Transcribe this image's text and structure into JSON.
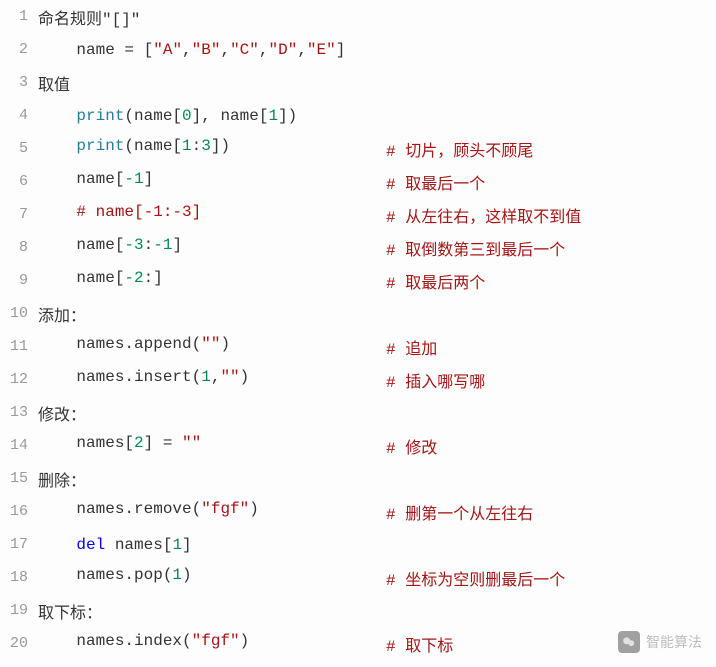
{
  "lines": [
    {
      "n": 1,
      "left": [
        {
          "t": "命名规则\"[]\"",
          "c": "tok-plain"
        }
      ],
      "right": []
    },
    {
      "n": 2,
      "left": [
        {
          "t": "    name ",
          "c": "tok-plain"
        },
        {
          "t": "=",
          "c": "tok-punct"
        },
        {
          "t": " [",
          "c": "tok-punct"
        },
        {
          "t": "\"A\"",
          "c": "tok-string"
        },
        {
          "t": ",",
          "c": "tok-punct"
        },
        {
          "t": "\"B\"",
          "c": "tok-string"
        },
        {
          "t": ",",
          "c": "tok-punct"
        },
        {
          "t": "\"C\"",
          "c": "tok-string"
        },
        {
          "t": ",",
          "c": "tok-punct"
        },
        {
          "t": "\"D\"",
          "c": "tok-string"
        },
        {
          "t": ",",
          "c": "tok-punct"
        },
        {
          "t": "\"E\"",
          "c": "tok-string"
        },
        {
          "t": "]",
          "c": "tok-punct"
        }
      ],
      "right": []
    },
    {
      "n": 3,
      "left": [
        {
          "t": "取值",
          "c": "tok-plain"
        }
      ],
      "right": []
    },
    {
      "n": 4,
      "left": [
        {
          "t": "    ",
          "c": "tok-plain"
        },
        {
          "t": "print",
          "c": "tok-builtin"
        },
        {
          "t": "(name[",
          "c": "tok-punct"
        },
        {
          "t": "0",
          "c": "tok-number"
        },
        {
          "t": "], name[",
          "c": "tok-punct"
        },
        {
          "t": "1",
          "c": "tok-number"
        },
        {
          "t": "])",
          "c": "tok-punct"
        }
      ],
      "right": []
    },
    {
      "n": 5,
      "left": [
        {
          "t": "    ",
          "c": "tok-plain"
        },
        {
          "t": "print",
          "c": "tok-builtin"
        },
        {
          "t": "(name[",
          "c": "tok-punct"
        },
        {
          "t": "1",
          "c": "tok-number"
        },
        {
          "t": ":",
          "c": "tok-punct"
        },
        {
          "t": "3",
          "c": "tok-number"
        },
        {
          "t": "])",
          "c": "tok-punct"
        }
      ],
      "right": [
        {
          "t": "# 切片，顾头不顾尾",
          "c": "tok-comment"
        }
      ]
    },
    {
      "n": 6,
      "left": [
        {
          "t": "    name[",
          "c": "tok-punct"
        },
        {
          "t": "-1",
          "c": "tok-number"
        },
        {
          "t": "]",
          "c": "tok-punct"
        }
      ],
      "right": [
        {
          "t": "# 取最后一个",
          "c": "tok-comment"
        }
      ]
    },
    {
      "n": 7,
      "left": [
        {
          "t": "    ",
          "c": "tok-plain"
        },
        {
          "t": "# name[-1:-3]",
          "c": "tok-comment"
        }
      ],
      "right": [
        {
          "t": "# 从左往右，这样取不到值",
          "c": "tok-comment"
        }
      ]
    },
    {
      "n": 8,
      "left": [
        {
          "t": "    name[",
          "c": "tok-punct"
        },
        {
          "t": "-3",
          "c": "tok-number"
        },
        {
          "t": ":",
          "c": "tok-punct"
        },
        {
          "t": "-1",
          "c": "tok-number"
        },
        {
          "t": "]",
          "c": "tok-punct"
        }
      ],
      "right": [
        {
          "t": "# 取倒数第三到最后一个",
          "c": "tok-comment"
        }
      ]
    },
    {
      "n": 9,
      "left": [
        {
          "t": "    name[",
          "c": "tok-punct"
        },
        {
          "t": "-2",
          "c": "tok-number"
        },
        {
          "t": ":]",
          "c": "tok-punct"
        }
      ],
      "right": [
        {
          "t": "# 取最后两个",
          "c": "tok-comment"
        }
      ]
    },
    {
      "n": 10,
      "left": [
        {
          "t": "添加：",
          "c": "tok-plain"
        }
      ],
      "right": []
    },
    {
      "n": 11,
      "left": [
        {
          "t": "    names.append(",
          "c": "tok-punct"
        },
        {
          "t": "\"\"",
          "c": "tok-string"
        },
        {
          "t": ")",
          "c": "tok-punct"
        }
      ],
      "right": [
        {
          "t": "# 追加",
          "c": "tok-comment"
        }
      ]
    },
    {
      "n": 12,
      "left": [
        {
          "t": "    names.insert(",
          "c": "tok-punct"
        },
        {
          "t": "1",
          "c": "tok-number"
        },
        {
          "t": ",",
          "c": "tok-punct"
        },
        {
          "t": "\"\"",
          "c": "tok-string"
        },
        {
          "t": ")",
          "c": "tok-punct"
        }
      ],
      "right": [
        {
          "t": "# 插入哪写哪",
          "c": "tok-comment"
        }
      ]
    },
    {
      "n": 13,
      "left": [
        {
          "t": "修改：",
          "c": "tok-plain"
        }
      ],
      "right": []
    },
    {
      "n": 14,
      "left": [
        {
          "t": "    names[",
          "c": "tok-punct"
        },
        {
          "t": "2",
          "c": "tok-number"
        },
        {
          "t": "] ",
          "c": "tok-punct"
        },
        {
          "t": "=",
          "c": "tok-punct"
        },
        {
          "t": " ",
          "c": "tok-plain"
        },
        {
          "t": "\"\"",
          "c": "tok-string"
        }
      ],
      "right": [
        {
          "t": "# 修改",
          "c": "tok-comment"
        }
      ]
    },
    {
      "n": 15,
      "left": [
        {
          "t": "删除：",
          "c": "tok-plain"
        }
      ],
      "right": []
    },
    {
      "n": 16,
      "left": [
        {
          "t": "    names.remove(",
          "c": "tok-punct"
        },
        {
          "t": "\"fgf\"",
          "c": "tok-string"
        },
        {
          "t": ")",
          "c": "tok-punct"
        }
      ],
      "right": [
        {
          "t": "# 删第一个从左往右",
          "c": "tok-comment"
        }
      ]
    },
    {
      "n": 17,
      "left": [
        {
          "t": "    ",
          "c": "tok-plain"
        },
        {
          "t": "del",
          "c": "tok-keyword"
        },
        {
          "t": " names[",
          "c": "tok-punct"
        },
        {
          "t": "1",
          "c": "tok-number"
        },
        {
          "t": "]",
          "c": "tok-punct"
        }
      ],
      "right": []
    },
    {
      "n": 18,
      "left": [
        {
          "t": "    names.pop(",
          "c": "tok-punct"
        },
        {
          "t": "1",
          "c": "tok-number"
        },
        {
          "t": ")",
          "c": "tok-punct"
        }
      ],
      "right": [
        {
          "t": "# 坐标为空则删最后一个",
          "c": "tok-comment"
        }
      ]
    },
    {
      "n": 19,
      "left": [
        {
          "t": "取下标：",
          "c": "tok-plain"
        }
      ],
      "right": []
    },
    {
      "n": 20,
      "left": [
        {
          "t": "    names.index(",
          "c": "tok-punct"
        },
        {
          "t": "\"fgf\"",
          "c": "tok-string"
        },
        {
          "t": ")",
          "c": "tok-punct"
        }
      ],
      "right": [
        {
          "t": "# 取下标",
          "c": "tok-comment"
        }
      ]
    }
  ],
  "watermark": "智能算法"
}
